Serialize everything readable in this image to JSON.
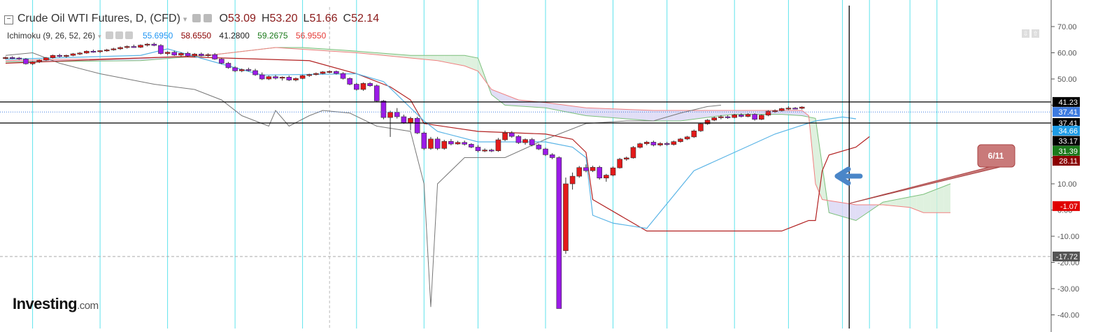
{
  "header": {
    "title": "Crude Oil WTI Futures, D, (CFD)",
    "ohlc": [
      {
        "key": "O",
        "value": "53.09"
      },
      {
        "key": "H",
        "value": "53.20"
      },
      {
        "key": "L",
        "value": "51.66"
      },
      {
        "key": "C",
        "value": "52.14"
      }
    ]
  },
  "indicator": {
    "name": "Ichimoku (9, 26, 52, 26)",
    "values": [
      {
        "value": "55.6950",
        "color": "#2196f3"
      },
      {
        "value": "58.6550",
        "color": "#8b0000"
      },
      {
        "value": "41.2800",
        "color": "#222222"
      },
      {
        "value": "59.2675",
        "color": "#1b7a1b"
      },
      {
        "value": "56.9550",
        "color": "#e53935"
      }
    ]
  },
  "logo": {
    "name": "Investing",
    "suffix": ".com"
  },
  "chart_data": {
    "type": "candlestick",
    "yaxis": {
      "ticks": [
        70,
        60,
        50,
        40,
        30,
        20,
        10,
        0,
        -10,
        -20,
        -30,
        -40
      ],
      "tick_labels": [
        "70.00",
        "60.00",
        "50.00",
        "40.00",
        "30.00",
        "20.00",
        "10.00",
        "0.00",
        "-10.00",
        "-20.00",
        "-30.00",
        "-40.00"
      ],
      "ylim": [
        -45,
        73
      ]
    },
    "price_badges": [
      {
        "label": "41.23",
        "value": 41.23,
        "bg": "#000000",
        "fg": "#ffffff"
      },
      {
        "label": "37.41",
        "value": 37.41,
        "bg": "#3d7be0",
        "fg": "#ffffff"
      },
      {
        "label": "37.41",
        "value": 33.2,
        "bg": "#000000",
        "fg": "#ffffff"
      },
      {
        "label": "34.66",
        "value": 30.3,
        "bg": "#1e9be5",
        "fg": "#ffffff"
      },
      {
        "label": "33.17",
        "value": 26.4,
        "bg": "#000000",
        "fg": "#ffffff"
      },
      {
        "label": "31.39",
        "value": 22.6,
        "bg": "#1b7a1b",
        "fg": "#ffffff"
      },
      {
        "label": "28.11",
        "value": 18.8,
        "bg": "#8b0000",
        "fg": "#ffffff"
      },
      {
        "label": "-1.07",
        "value": 1.5,
        "bg": "#e00000",
        "fg": "#ffffff"
      },
      {
        "label": "-17.72",
        "value": -17.72,
        "bg": "#555555",
        "fg": "#ffffff"
      }
    ],
    "hlines": [
      41.23,
      33.2
    ],
    "dotted_hline": 37.41,
    "dashed_hline": -17.72,
    "crosshair_x_index": 125,
    "annotation": {
      "label": "6/11",
      "color": "#c97a7a"
    },
    "candles": [
      {
        "o": 58,
        "h": 58.6,
        "l": 57.5,
        "c": 58.2
      },
      {
        "o": 58.2,
        "h": 58.7,
        "l": 57.6,
        "c": 58.0
      },
      {
        "o": 58,
        "h": 58.4,
        "l": 57.3,
        "c": 57.6
      },
      {
        "o": 57.6,
        "h": 58,
        "l": 55.5,
        "c": 55.8
      },
      {
        "o": 55.8,
        "h": 56.8,
        "l": 55.3,
        "c": 56.5
      },
      {
        "o": 56.5,
        "h": 57.5,
        "l": 56.1,
        "c": 57.2
      },
      {
        "o": 57.2,
        "h": 58.4,
        "l": 56.9,
        "c": 58.1
      },
      {
        "o": 58.1,
        "h": 59.3,
        "l": 57.8,
        "c": 59.0
      },
      {
        "o": 59,
        "h": 59.6,
        "l": 58.2,
        "c": 58.6
      },
      {
        "o": 58.6,
        "h": 59.3,
        "l": 58.1,
        "c": 59.0
      },
      {
        "o": 59,
        "h": 59.9,
        "l": 58.7,
        "c": 59.6
      },
      {
        "o": 59.6,
        "h": 60.3,
        "l": 59.1,
        "c": 59.9
      },
      {
        "o": 59.9,
        "h": 60.9,
        "l": 59.6,
        "c": 60.6
      },
      {
        "o": 60.6,
        "h": 61.2,
        "l": 60.0,
        "c": 60.4
      },
      {
        "o": 60.4,
        "h": 61.0,
        "l": 59.9,
        "c": 60.8
      },
      {
        "o": 60.8,
        "h": 61.5,
        "l": 60.4,
        "c": 61.1
      },
      {
        "o": 61.1,
        "h": 61.9,
        "l": 60.8,
        "c": 61.5
      },
      {
        "o": 61.5,
        "h": 62.4,
        "l": 61.1,
        "c": 62.0
      },
      {
        "o": 62,
        "h": 62.8,
        "l": 61.6,
        "c": 62.4
      },
      {
        "o": 62.4,
        "h": 63.1,
        "l": 61.9,
        "c": 62.1
      },
      {
        "o": 62.1,
        "h": 63.2,
        "l": 61.8,
        "c": 62.9
      },
      {
        "o": 62.9,
        "h": 63.7,
        "l": 62.4,
        "c": 63.3
      },
      {
        "o": 63.3,
        "h": 63.9,
        "l": 62.5,
        "c": 62.8
      },
      {
        "o": 62.8,
        "h": 63.3,
        "l": 59.3,
        "c": 59.7
      },
      {
        "o": 59.7,
        "h": 60.6,
        "l": 59.1,
        "c": 60.2
      },
      {
        "o": 60.2,
        "h": 60.8,
        "l": 58.8,
        "c": 59.1
      },
      {
        "o": 59.1,
        "h": 60.2,
        "l": 58.6,
        "c": 59.8
      },
      {
        "o": 59.8,
        "h": 60.4,
        "l": 58.4,
        "c": 58.8
      },
      {
        "o": 58.8,
        "h": 59.9,
        "l": 58.3,
        "c": 59.5
      },
      {
        "o": 59.5,
        "h": 60.1,
        "l": 58.6,
        "c": 58.9
      },
      {
        "o": 58.9,
        "h": 59.8,
        "l": 58.4,
        "c": 59.3
      },
      {
        "o": 59.3,
        "h": 59.9,
        "l": 57.3,
        "c": 57.6
      },
      {
        "o": 57.6,
        "h": 58,
        "l": 55.6,
        "c": 56.0
      },
      {
        "o": 56,
        "h": 56.5,
        "l": 53.9,
        "c": 54.3
      },
      {
        "o": 54.3,
        "h": 54.9,
        "l": 52.6,
        "c": 53.1
      },
      {
        "o": 53.1,
        "h": 54.0,
        "l": 52.6,
        "c": 53.6
      },
      {
        "o": 53.6,
        "h": 54.3,
        "l": 52.9,
        "c": 53.2
      },
      {
        "o": 53.2,
        "h": 53.9,
        "l": 51.2,
        "c": 51.6
      },
      {
        "o": 51.6,
        "h": 52.5,
        "l": 49.6,
        "c": 50.0
      },
      {
        "o": 50,
        "h": 51.3,
        "l": 49.6,
        "c": 50.9
      },
      {
        "o": 50.9,
        "h": 51.5,
        "l": 49.8,
        "c": 50.3
      },
      {
        "o": 50.3,
        "h": 51.0,
        "l": 49.4,
        "c": 50.7
      },
      {
        "o": 50.7,
        "h": 51.3,
        "l": 49.2,
        "c": 49.6
      },
      {
        "o": 49.6,
        "h": 50.6,
        "l": 49.1,
        "c": 50.2
      },
      {
        "o": 50.2,
        "h": 51.6,
        "l": 49.9,
        "c": 51.3
      },
      {
        "o": 51.3,
        "h": 52.0,
        "l": 50.8,
        "c": 51.7
      },
      {
        "o": 51.7,
        "h": 52.5,
        "l": 51.3,
        "c": 52.1
      },
      {
        "o": 52.1,
        "h": 53.0,
        "l": 51.8,
        "c": 52.7
      },
      {
        "o": 52.7,
        "h": 53.3,
        "l": 52.2,
        "c": 52.9
      },
      {
        "o": 52.9,
        "h": 53.2,
        "l": 51.7,
        "c": 52.1
      },
      {
        "o": 52.1,
        "h": 52.6,
        "l": 49.8,
        "c": 50.2
      },
      {
        "o": 50.2,
        "h": 50.6,
        "l": 47.6,
        "c": 48.0
      },
      {
        "o": 48,
        "h": 48.5,
        "l": 45.6,
        "c": 46.0
      },
      {
        "o": 46,
        "h": 48.7,
        "l": 45.5,
        "c": 48.3
      },
      {
        "o": 48.3,
        "h": 48.8,
        "l": 47.0,
        "c": 47.4
      },
      {
        "o": 47.4,
        "h": 47.9,
        "l": 41.1,
        "c": 41.6
      },
      {
        "o": 41.6,
        "h": 42,
        "l": 34.6,
        "c": 35.3
      },
      {
        "o": 35.3,
        "h": 37.9,
        "l": 27.9,
        "c": 37.3
      },
      {
        "o": 37.3,
        "h": 38.9,
        "l": 34.9,
        "c": 35.6
      },
      {
        "o": 35.6,
        "h": 36.4,
        "l": 32.9,
        "c": 33.3
      },
      {
        "o": 33.3,
        "h": 35.6,
        "l": 30.4,
        "c": 35.0
      },
      {
        "o": 35,
        "h": 35.6,
        "l": 29.0,
        "c": 29.4
      },
      {
        "o": 29.4,
        "h": 29.9,
        "l": 22.9,
        "c": 23.5
      },
      {
        "o": 23.5,
        "h": 27.9,
        "l": 23.0,
        "c": 27.1
      },
      {
        "o": 27.1,
        "h": 27.9,
        "l": 22.9,
        "c": 23.5
      },
      {
        "o": 23.5,
        "h": 26.8,
        "l": 23.0,
        "c": 26.2
      },
      {
        "o": 26.2,
        "h": 27.1,
        "l": 24.7,
        "c": 25.2
      },
      {
        "o": 25.2,
        "h": 26.4,
        "l": 24.9,
        "c": 25.8
      },
      {
        "o": 25.8,
        "h": 26.5,
        "l": 24.6,
        "c": 25.1
      },
      {
        "o": 25.1,
        "h": 25.5,
        "l": 23.6,
        "c": 24.0
      },
      {
        "o": 24,
        "h": 24.8,
        "l": 22.0,
        "c": 22.6
      },
      {
        "o": 22.6,
        "h": 23.5,
        "l": 22.1,
        "c": 22.9
      },
      {
        "o": 22.9,
        "h": 23.4,
        "l": 22.1,
        "c": 22.6
      },
      {
        "o": 22.6,
        "h": 27.5,
        "l": 22.2,
        "c": 26.8
      },
      {
        "o": 26.8,
        "h": 30.3,
        "l": 26.3,
        "c": 29.4
      },
      {
        "o": 29.4,
        "h": 30.1,
        "l": 27.6,
        "c": 28.1
      },
      {
        "o": 28.1,
        "h": 28.6,
        "l": 25.2,
        "c": 25.7
      },
      {
        "o": 25.7,
        "h": 27.3,
        "l": 24.9,
        "c": 26.9
      },
      {
        "o": 26.9,
        "h": 27.5,
        "l": 24.3,
        "c": 24.8
      },
      {
        "o": 24.8,
        "h": 25.3,
        "l": 22.9,
        "c": 23.3
      },
      {
        "o": 23.3,
        "h": 23.8,
        "l": 20.6,
        "c": 21.1
      },
      {
        "o": 21.1,
        "h": 21.7,
        "l": 19.4,
        "c": 20.0
      },
      {
        "o": 20,
        "h": 20.5,
        "l": -2.2,
        "c": -37.6
      },
      {
        "o": -15.5,
        "h": 12.4,
        "l": -16.7,
        "c": 10.0
      },
      {
        "o": 10,
        "h": 14.3,
        "l": 7.8,
        "c": 12.9
      },
      {
        "o": 12.9,
        "h": 16.8,
        "l": 12.3,
        "c": 16.2
      },
      {
        "o": 16.2,
        "h": 17.4,
        "l": 14.4,
        "c": 15.0
      },
      {
        "o": 15,
        "h": 16.9,
        "l": 14.5,
        "c": 16.3
      },
      {
        "o": 16.3,
        "h": 16.9,
        "l": 11.6,
        "c": 12.2
      },
      {
        "o": 12.2,
        "h": 13.8,
        "l": 10.8,
        "c": 13.3
      },
      {
        "o": 13.3,
        "h": 16.6,
        "l": 12.9,
        "c": 16.1
      },
      {
        "o": 16.1,
        "h": 19.9,
        "l": 15.8,
        "c": 19.4
      },
      {
        "o": 19.4,
        "h": 20.4,
        "l": 18.8,
        "c": 19.9
      },
      {
        "o": 19.9,
        "h": 24.4,
        "l": 19.6,
        "c": 23.9
      },
      {
        "o": 23.9,
        "h": 25.7,
        "l": 23.5,
        "c": 25.3
      },
      {
        "o": 25.3,
        "h": 26.4,
        "l": 24.7,
        "c": 25.9
      },
      {
        "o": 25.9,
        "h": 26.5,
        "l": 24.3,
        "c": 24.8
      },
      {
        "o": 24.8,
        "h": 25.9,
        "l": 24.3,
        "c": 25.4
      },
      {
        "o": 25.4,
        "h": 26.0,
        "l": 24.5,
        "c": 25.0
      },
      {
        "o": 25,
        "h": 26.5,
        "l": 24.6,
        "c": 26.1
      },
      {
        "o": 26.1,
        "h": 27.5,
        "l": 25.7,
        "c": 27.1
      },
      {
        "o": 27.1,
        "h": 28.3,
        "l": 26.7,
        "c": 27.9
      },
      {
        "o": 27.9,
        "h": 30.7,
        "l": 27.5,
        "c": 30.2
      },
      {
        "o": 30.2,
        "h": 33.3,
        "l": 29.8,
        "c": 32.9
      },
      {
        "o": 32.9,
        "h": 34.7,
        "l": 32.5,
        "c": 34.3
      },
      {
        "o": 34.3,
        "h": 35.6,
        "l": 33.9,
        "c": 35.2
      },
      {
        "o": 35.2,
        "h": 36.2,
        "l": 34.6,
        "c": 35.6
      },
      {
        "o": 35.6,
        "h": 36.1,
        "l": 34.8,
        "c": 35.3
      },
      {
        "o": 35.3,
        "h": 36.7,
        "l": 35.0,
        "c": 36.3
      },
      {
        "o": 36.3,
        "h": 36.9,
        "l": 35.3,
        "c": 35.7
      },
      {
        "o": 35.7,
        "h": 36.9,
        "l": 35.4,
        "c": 36.5
      },
      {
        "o": 36.5,
        "h": 36.9,
        "l": 34.1,
        "c": 34.6
      },
      {
        "o": 34.6,
        "h": 36.5,
        "l": 34.3,
        "c": 36.2
      },
      {
        "o": 36.2,
        "h": 38.1,
        "l": 35.8,
        "c": 37.7
      },
      {
        "o": 37.7,
        "h": 38.4,
        "l": 37.1,
        "c": 37.9
      },
      {
        "o": 37.9,
        "h": 39.0,
        "l": 37.6,
        "c": 38.7
      },
      {
        "o": 38.7,
        "h": 39.6,
        "l": 38.2,
        "c": 38.9
      },
      {
        "o": 38.9,
        "h": 39.3,
        "l": 38.5,
        "c": 38.8
      },
      {
        "o": 38.8,
        "h": 39.6,
        "l": 38.4,
        "c": 39.3
      }
    ],
    "tenkan": [
      [
        0,
        57.5
      ],
      [
        20,
        59
      ],
      [
        24,
        61.5
      ],
      [
        33,
        55
      ],
      [
        38,
        51.5
      ],
      [
        52,
        52
      ],
      [
        56,
        49
      ],
      [
        62,
        34
      ],
      [
        64,
        30
      ],
      [
        70,
        26
      ],
      [
        80,
        26
      ],
      [
        84,
        24
      ],
      [
        86,
        20
      ],
      [
        87,
        -2
      ],
      [
        90,
        -5
      ],
      [
        95,
        -7
      ],
      [
        102,
        15
      ],
      [
        108,
        22
      ],
      [
        114,
        29
      ],
      [
        120,
        34
      ],
      [
        124,
        35.5
      ],
      [
        126,
        34.8
      ]
    ],
    "kijun": [
      [
        0,
        56
      ],
      [
        20,
        58
      ],
      [
        26,
        58.5
      ],
      [
        45,
        57
      ],
      [
        52,
        52
      ],
      [
        57,
        47
      ],
      [
        60,
        42
      ],
      [
        62,
        33
      ],
      [
        70,
        30
      ],
      [
        80,
        29
      ],
      [
        84,
        27
      ],
      [
        86,
        22
      ],
      [
        87,
        4
      ],
      [
        95,
        -8
      ],
      [
        115,
        -8
      ],
      [
        119,
        -4
      ],
      [
        120,
        -4
      ],
      [
        121,
        15
      ],
      [
        122,
        21
      ],
      [
        126,
        24
      ],
      [
        128,
        28
      ]
    ],
    "chikou": [
      [
        0,
        59
      ],
      [
        4,
        60
      ],
      [
        8,
        56
      ],
      [
        14,
        52
      ],
      [
        22,
        48
      ],
      [
        28,
        46
      ],
      [
        32,
        42
      ],
      [
        35,
        36
      ],
      [
        39,
        32
      ],
      [
        40,
        38
      ],
      [
        42,
        32
      ],
      [
        45,
        36
      ],
      [
        47,
        38
      ],
      [
        51,
        37
      ],
      [
        55,
        32
      ],
      [
        60,
        30
      ],
      [
        62,
        10
      ],
      [
        63,
        -37
      ],
      [
        64,
        10
      ],
      [
        68,
        20
      ],
      [
        74,
        20
      ],
      [
        80,
        27
      ],
      [
        86,
        33
      ],
      [
        92,
        34
      ],
      [
        96,
        34
      ],
      [
        100,
        37
      ],
      [
        104,
        39.5
      ],
      [
        106,
        40
      ]
    ],
    "span_a": [
      [
        0,
        56.5
      ],
      [
        20,
        57
      ],
      [
        30,
        59
      ],
      [
        40,
        62
      ],
      [
        44,
        62
      ],
      [
        50,
        61
      ],
      [
        60,
        59
      ],
      [
        68,
        59
      ],
      [
        70,
        58
      ],
      [
        72,
        44
      ],
      [
        74,
        40
      ],
      [
        80,
        39
      ],
      [
        86,
        36
      ],
      [
        96,
        34
      ],
      [
        100,
        34
      ],
      [
        106,
        36
      ],
      [
        108,
        36.5
      ],
      [
        115,
        36.5
      ],
      [
        118,
        36
      ],
      [
        120,
        35
      ],
      [
        122,
        -1
      ],
      [
        126,
        -4
      ],
      [
        130,
        3
      ],
      [
        136,
        6
      ],
      [
        140,
        10
      ]
    ],
    "span_b": [
      [
        0,
        57
      ],
      [
        20,
        58
      ],
      [
        30,
        59
      ],
      [
        40,
        62
      ],
      [
        52,
        60
      ],
      [
        60,
        58
      ],
      [
        64,
        57
      ],
      [
        68,
        55
      ],
      [
        70,
        53
      ],
      [
        72,
        46
      ],
      [
        76,
        42
      ],
      [
        80,
        41
      ],
      [
        86,
        39
      ],
      [
        96,
        38
      ],
      [
        118,
        38
      ],
      [
        119,
        36
      ],
      [
        120,
        10
      ],
      [
        121,
        4
      ],
      [
        126,
        2
      ],
      [
        130,
        2
      ],
      [
        134,
        1
      ],
      [
        136,
        -1
      ],
      [
        140,
        -1
      ]
    ],
    "x_cycles": [
      4,
      14,
      24,
      34,
      44,
      52,
      62,
      70,
      80,
      90,
      98,
      108,
      116,
      124,
      128,
      134,
      138
    ]
  }
}
